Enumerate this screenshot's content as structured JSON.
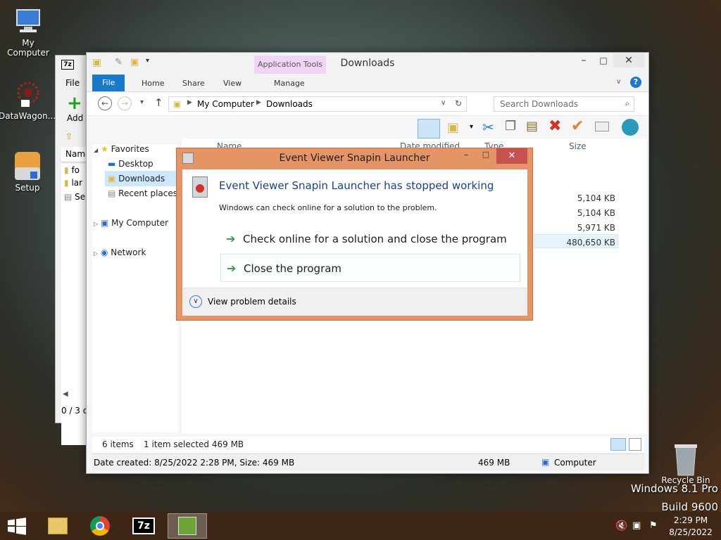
{
  "desktop": {
    "icons": [
      {
        "label": "My Computer"
      },
      {
        "label": "DataWagon..."
      },
      {
        "label": "Setup"
      },
      {
        "label": "Recycle Bin"
      }
    ],
    "watermark_line1": "Windows 8.1 Pro",
    "watermark_line2": "Build 9600"
  },
  "sevenzip_window": {
    "menu_file": "File",
    "add_label": "Add",
    "col_name": "Name",
    "rows": [
      "fo",
      "lar",
      "Se"
    ],
    "status": "0 / 3 o"
  },
  "explorer": {
    "title": "Downloads",
    "tabs": {
      "file": "File",
      "home": "Home",
      "share": "Share",
      "view": "View",
      "manage": "Manage",
      "app_tools": "Application Tools"
    },
    "address": {
      "root": "My Computer",
      "current": "Downloads"
    },
    "search_placeholder": "Search Downloads",
    "nav": {
      "favorites": "Favorites",
      "desktop": "Desktop",
      "downloads": "Downloads",
      "recent": "Recent places",
      "computer": "My Computer",
      "network": "Network"
    },
    "columns": {
      "name": "Name",
      "date": "Date modified",
      "type": "Type",
      "size": "Size"
    },
    "sizes": [
      "5,104 KB",
      "5,104 KB",
      "5,971 KB",
      "480,650 KB"
    ],
    "status": {
      "items": "6 items",
      "selected": "1 item selected  469 MB"
    },
    "details": {
      "created": "Date created: 8/25/2022 2:28 PM, Size: 469 MB",
      "size": "469 MB",
      "location": "Computer"
    }
  },
  "dialog": {
    "title": "Event Viewer Snapin Launcher",
    "heading": "Event Viewer Snapin Launcher has stopped working",
    "message": "Windows can check online for a solution to the problem.",
    "option1": "Check online for a solution and close the program",
    "option2": "Close the program",
    "details": "View problem details"
  },
  "taskbar": {
    "time": "2:29 PM",
    "date": "8/25/2022"
  },
  "colors": {
    "accent": "#1979ca",
    "dialog_frame": "#e59466",
    "heading": "#1d3f8e"
  }
}
